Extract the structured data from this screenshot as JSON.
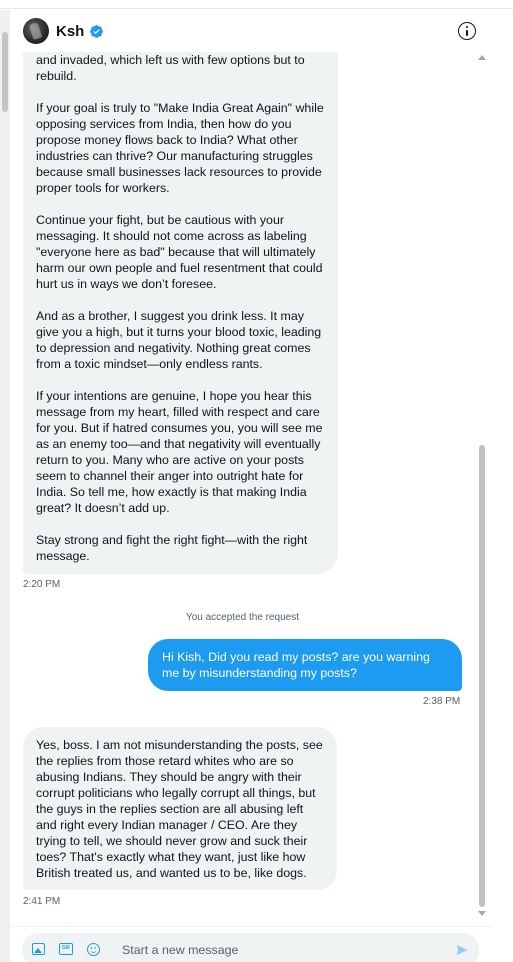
{
  "header": {
    "name": "Ksh",
    "verified_icon": "verified-badge-icon",
    "info_icon": "info-icon"
  },
  "messages": [
    {
      "direction": "incoming",
      "text": "and invaded, which left us with few options but to rebuild.\n\nIf your goal is truly to \"Make India Great Again\" while opposing services from India, then how do you propose money flows back to India? What other industries can thrive? Our manufacturing struggles because small businesses lack resources to provide proper tools for workers.\n\nContinue your fight, but be cautious with your messaging. It should not come across as labeling \"everyone here as bad\" because that will ultimately harm our own people and fuel resentment that could hurt us in ways we don’t foresee.\n\nAnd as a brother, I suggest you drink less. It may give you a high, but it turns your blood toxic, leading to depression and negativity. Nothing great comes from a toxic mindset—only endless rants.\n\nIf your intentions are genuine, I hope you hear this message from my heart, filled with respect and care for you. But if hatred consumes you, you will see me as an enemy too—and that negativity will eventually return to you. Many who are active on your posts seem to channel their anger into outright hate for India. So tell me, how exactly is that making India great? It doesn’t add up.\n\nStay strong and fight the right fight—with the right message.",
      "time": "2:20 PM"
    },
    {
      "direction": "outgoing",
      "text": "Hi Kish, Did you read my posts? are you warning me by misunderstanding my posts?",
      "time": "2:38 PM"
    },
    {
      "direction": "incoming",
      "text": "Yes, boss. I am not misunderstanding the posts, see the replies from those retard whites who are so abusing Indians. They should be angry with their corrupt politicians who legally corrupt all things, but the guys in the replies section are all abusing left and right every Indian manager / CEO. Are they trying to tell, we should never grow and suck their toes? That's exactly what they want, just like how British treated us, and wanted us to be, like dogs.",
      "time": "2:41 PM"
    }
  ],
  "system_notice": "You accepted the request",
  "composer": {
    "placeholder": "Start a new message",
    "icons": [
      "image-icon",
      "gif-icon",
      "emoji-icon",
      "send-icon"
    ],
    "gif_label": "GIF"
  },
  "colors": {
    "accent": "#1d9bf0",
    "incoming_bubble": "#eff3f4",
    "muted_text": "#536471"
  }
}
